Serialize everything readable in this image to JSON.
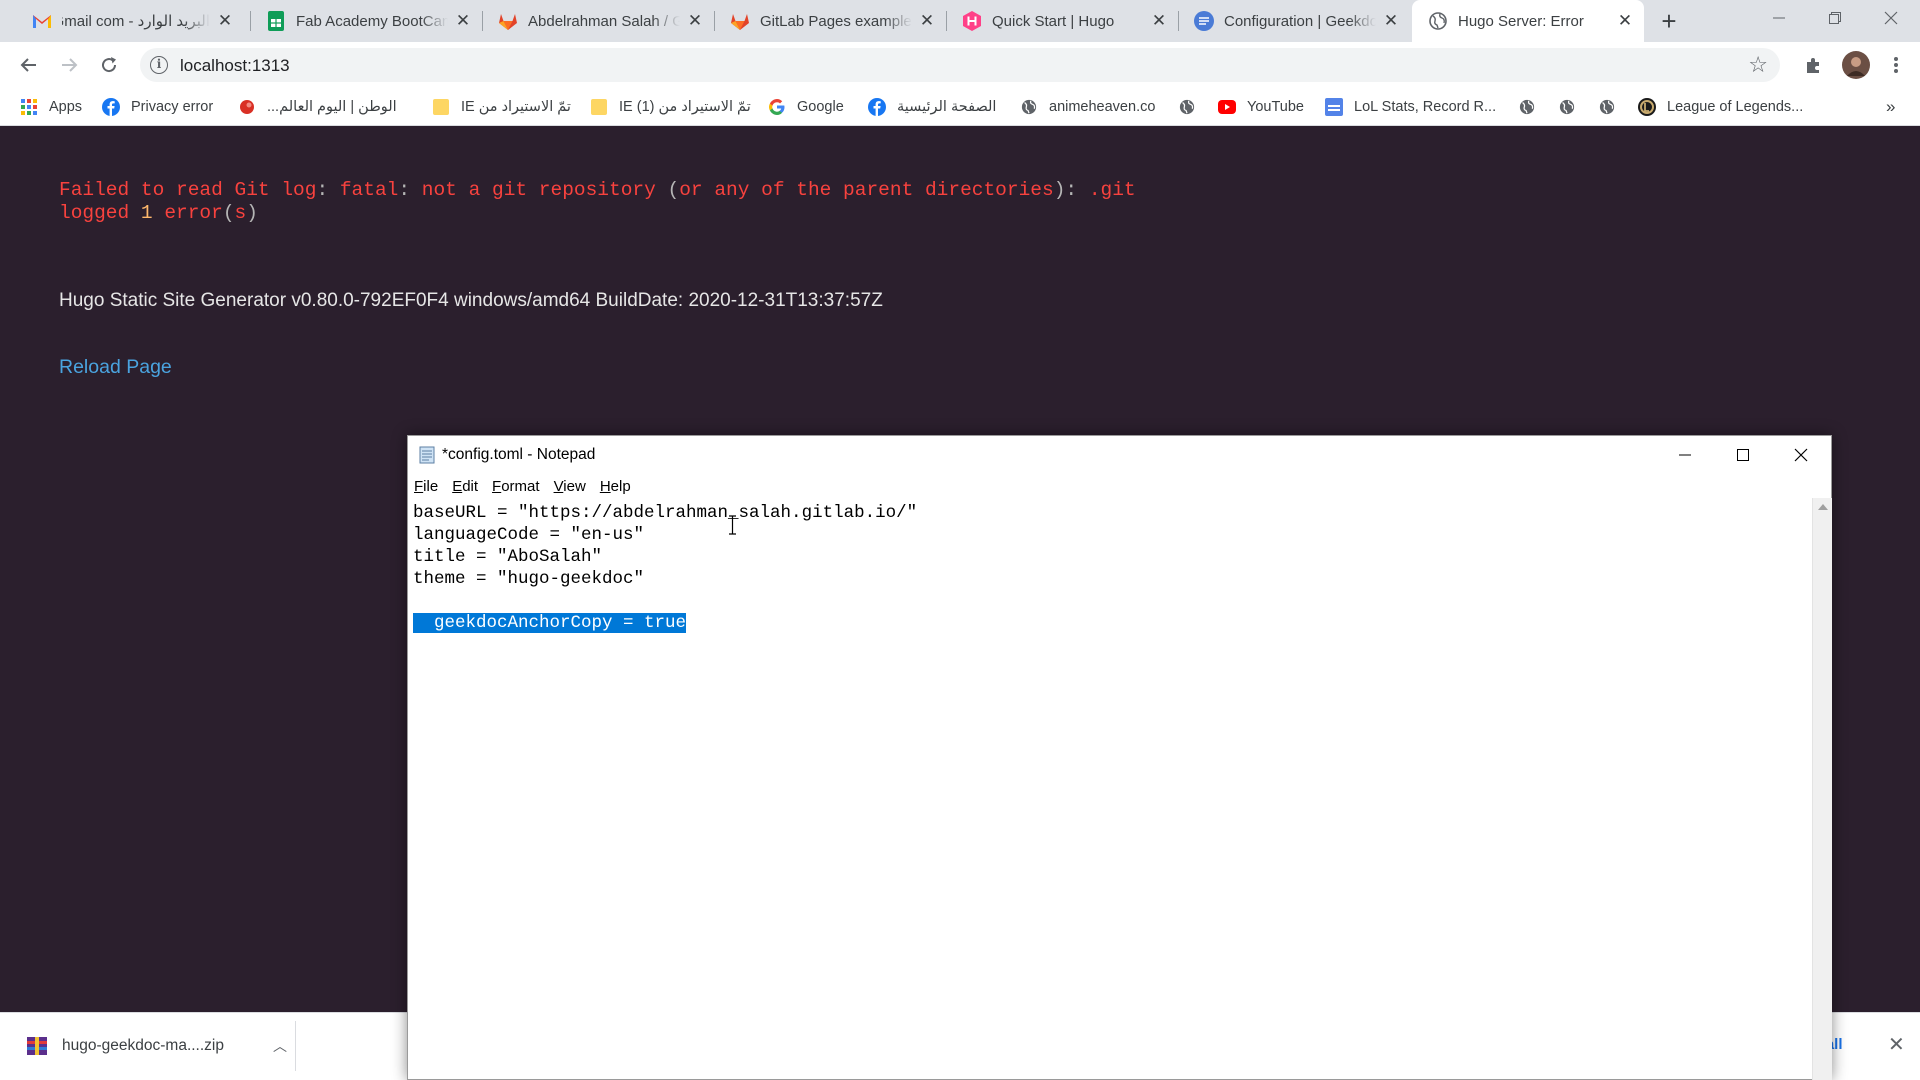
{
  "browser": {
    "tabs": [
      {
        "label": "البريد الوارد - Gmail com",
        "icon": "gmail-icon",
        "active": false
      },
      {
        "label": "Fab Academy BootCamp",
        "icon": "google-sheets-icon",
        "active": false
      },
      {
        "label": "Abdelrahman Salah / G",
        "icon": "gitlab-icon",
        "active": false
      },
      {
        "label": "GitLab Pages examples",
        "icon": "gitlab-icon",
        "active": false
      },
      {
        "label": "Quick Start | Hugo",
        "icon": "hugo-icon",
        "active": false
      },
      {
        "label": "Configuration | Geekdo",
        "icon": "google-docs-icon",
        "active": false
      },
      {
        "label": "Hugo Server: Error",
        "icon": "globe-icon",
        "active": true
      }
    ],
    "url": "localhost:1313",
    "bookmarks": [
      {
        "label": "Apps",
        "icon": "apps-grid-icon"
      },
      {
        "label": "Privacy error",
        "icon": "facebook-icon"
      },
      {
        "label": "الوطن | اليوم العالم...",
        "icon": "red-dot-icon"
      },
      {
        "label": "تمّ الاستيراد من IE",
        "icon": "folder-icon"
      },
      {
        "label": "تمّ الاستيراد من (1) IE",
        "icon": "folder-icon"
      },
      {
        "label": "Google",
        "icon": "google-icon"
      },
      {
        "label": "الصفحة الرئيسية",
        "icon": "facebook-icon"
      },
      {
        "label": "animeheaven.co",
        "icon": "globe-icon"
      },
      {
        "label": "",
        "icon": "globe-icon"
      },
      {
        "label": "YouTube",
        "icon": "youtube-icon"
      },
      {
        "label": "LoL Stats, Record R...",
        "icon": "lol-stats-icon"
      },
      {
        "label": "",
        "icon": "globe-icon"
      },
      {
        "label": "",
        "icon": "globe-icon"
      },
      {
        "label": "",
        "icon": "globe-icon"
      },
      {
        "label": "League of Legends...",
        "icon": "league-icon"
      }
    ],
    "bookmarks_overflow": "»"
  },
  "page": {
    "error_line1": {
      "prefix": "Failed to read Git log",
      "sep1": ": ",
      "word1": "fatal",
      "sep2": ": ",
      "message": "not a git repository ",
      "paren_open": "(",
      "paren_text": "or any of the parent directories",
      "paren_close": ")",
      "colon": ": ",
      "path": ".git"
    },
    "error_line2": {
      "word": "logged ",
      "count": "1",
      "tail_word": " error",
      "paren_open": "(",
      "s": "s",
      "paren_close": ")"
    },
    "hugo_info": "Hugo Static Site Generator v0.80.0-792EF0F4 windows/amd64 BuildDate: 2020-12-31T13:37:57Z",
    "reload_label": "Reload Page"
  },
  "notepad": {
    "title": "*config.toml - Notepad",
    "menu": [
      "File",
      "Edit",
      "Format",
      "View",
      "Help"
    ],
    "lines": [
      "baseURL = \"https://abdelrahman_salah.gitlab.io/\"",
      "languageCode = \"en-us\"",
      "title = \"AboSalah\"",
      "theme = \"hugo-geekdoc\"",
      "",
      "  geekdocAnchorCopy = true"
    ],
    "selected_line_index": 5
  },
  "downloads": {
    "filename": "hugo-geekdoc-ma....zip",
    "show_all_label": "w all"
  },
  "colors": {
    "page_bg": "#2b1f2d",
    "error_red": "#f8423e",
    "link_blue": "#4aa3df",
    "selection_blue": "#0078d7"
  }
}
